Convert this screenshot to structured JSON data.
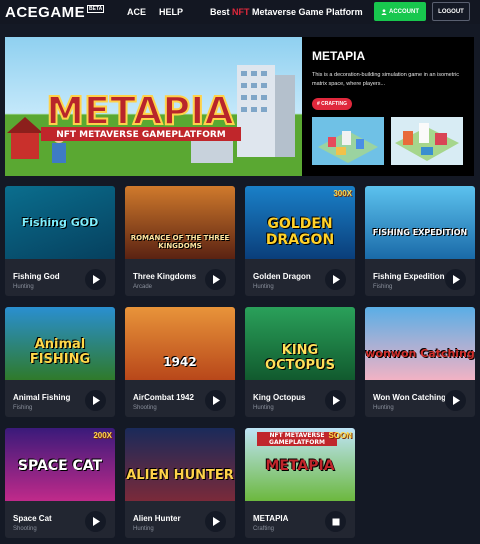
{
  "header": {
    "logo": "ACEGAME",
    "beta": "BETA",
    "nav": [
      {
        "label": "ACE"
      },
      {
        "label": "HELP"
      }
    ],
    "tagline_pre": "Best ",
    "tagline_nft": "NFT",
    "tagline_post": " Metaverse Game Platform",
    "account_label": "ACCOUNT",
    "logout_label": "LOGOUT"
  },
  "featured": {
    "banner_title": "METAPIA",
    "banner_subtitle": "NFT METAVERSE GAMEPLATFORM",
    "title": "METAPIA",
    "description": "This is a decoration-building simulation game in an isometric matrix space, where players...",
    "tag": "# CRAFTING"
  },
  "games": [
    {
      "name": "Fishing God",
      "genre": "Hunting",
      "art": "Fishing GOD"
    },
    {
      "name": "Three Kingdoms",
      "genre": "Arcade",
      "art": "ROMANCE OF THE THREE KINGDOMS"
    },
    {
      "name": "Golden Dragon",
      "genre": "Hunting",
      "art": "GOLDEN DRAGON",
      "badge": "300X"
    },
    {
      "name": "Fishing Expedition",
      "genre": "Fishing",
      "art": "FISHING EXPEDITION"
    },
    {
      "name": "Animal Fishing",
      "genre": "Fishing",
      "art": "Animal FISHING"
    },
    {
      "name": "AirCombat 1942",
      "genre": "Shooting",
      "art": "1942"
    },
    {
      "name": "King Octopus",
      "genre": "Hunting",
      "art": "KING OCTOPUS"
    },
    {
      "name": "Won Won Catching",
      "genre": "Hunting",
      "art": "wonwon Catching"
    },
    {
      "name": "Space Cat",
      "genre": "Shooting",
      "art": "SPACE CAT",
      "badge": "200X"
    },
    {
      "name": "Alien Hunter",
      "genre": "Hunting",
      "art": "ALIEN HUNTER"
    },
    {
      "name": "METAPIA",
      "genre": "Crafting",
      "art": "METAPIA",
      "art_top": "NFT METAVERSE GAMEPLATFORM",
      "badge": "SOON"
    }
  ],
  "colors": {
    "accent_green": "#18c74e",
    "accent_red": "#e0283c",
    "bg": "#141925",
    "card": "#222631"
  }
}
